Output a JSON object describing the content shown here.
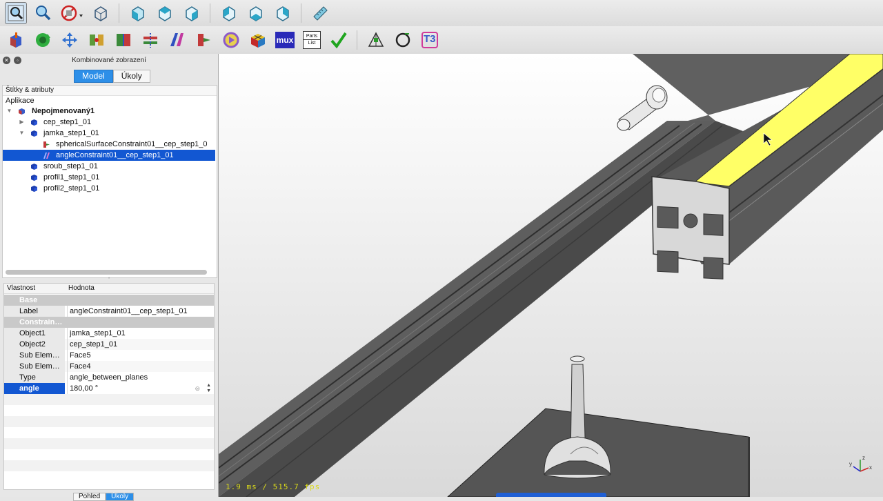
{
  "toolbar_top": {
    "icons": [
      "fit-all-icon",
      "fit-selection-icon",
      "draw-style-icon",
      "isometric-view-icon",
      "front-view-icon",
      "top-view-icon",
      "right-view-icon",
      "rear-view-icon",
      "bottom-view-icon",
      "left-view-icon",
      "measure-icon"
    ]
  },
  "toolbar_assembly": {
    "icons": [
      "import-part-icon",
      "update-assembly-icon",
      "move-part-icon",
      "constraint-point-icon",
      "constraint-plane-icon",
      "constraint-axial-icon",
      "constraint-angle-icon",
      "constraint-sphere-icon",
      "animate-icon",
      "rubiks-cube-icon",
      "mux-icon",
      "parts-list-icon",
      "solve-icon",
      "constraint-triangle-icon",
      "circle-icon",
      "t3-icon"
    ],
    "mux_label": "mux",
    "parts_list_label_1": "Parts",
    "parts_list_label_2": "List",
    "t3_label": "T3"
  },
  "combo_view": {
    "title": "Kombinované zobrazení",
    "tabs": [
      "Model",
      "Úkoly"
    ],
    "active_tab": "Model"
  },
  "tree": {
    "header": "Štítky & atributy",
    "root": "Aplikace",
    "items": [
      {
        "label": "Nepojmenovaný1",
        "bold": true
      },
      {
        "label": "cep_step1_01"
      },
      {
        "label": "jamka_step1_01"
      },
      {
        "label": "sphericalSurfaceConstraint01__cep_step1_0"
      },
      {
        "label": "angleConstraint01__cep_step1_01",
        "selected": true
      },
      {
        "label": "sroub_step1_01"
      },
      {
        "label": "profil1_step1_01"
      },
      {
        "label": "profil2_step1_01"
      }
    ]
  },
  "properties": {
    "col_property": "Vlastnost",
    "col_value": "Hodnota",
    "group_base": "Base",
    "group_constraint": "Constrain…",
    "rows": [
      {
        "name": "Label",
        "value": "angleConstraint01__cep_step1_01"
      },
      {
        "name": "Object1",
        "value": "jamka_step1_01"
      },
      {
        "name": "Object2",
        "value": "cep_step1_01"
      },
      {
        "name": "Sub Elem…",
        "value": "Face5"
      },
      {
        "name": "Sub Elem…",
        "value": "Face4"
      },
      {
        "name": "Type",
        "value": "angle_between_planes"
      },
      {
        "name": "angle",
        "value": "180,00 °",
        "selected": true
      }
    ]
  },
  "bottom_tabs": [
    "Pohled",
    "Úkoly"
  ],
  "viewport": {
    "fps": "1.9 ms / 515.7 fps",
    "axis_x": "x",
    "axis_y": "y",
    "axis_z": "z"
  },
  "colors": {
    "selection_blue": "#1257d2",
    "tab_blue": "#2d8fe8",
    "highlight_yellow": "#ffff66",
    "profile_gray": "#5c5c5c"
  }
}
